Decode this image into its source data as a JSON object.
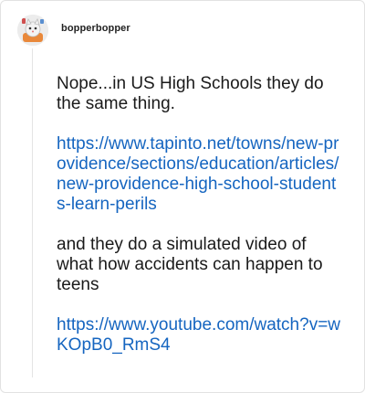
{
  "post": {
    "username": "bopperbopper",
    "avatar_icon": "cat-avatar-icon",
    "paragraph_1": "Nope...in US High Schools they do the same thing.",
    "link_1": "https://www.tapinto.net/towns/new-providence/sections/education/articles/new-providence-high-school-students-learn-perils",
    "paragraph_2": "and they do a simulated video of what how accidents can happen to teens",
    "link_2": "https://www.youtube.com/watch?v=wKOpB0_RmS4"
  },
  "colors": {
    "link": "#1565c0",
    "text": "#1a1a1a",
    "border": "#e2e2e2"
  }
}
